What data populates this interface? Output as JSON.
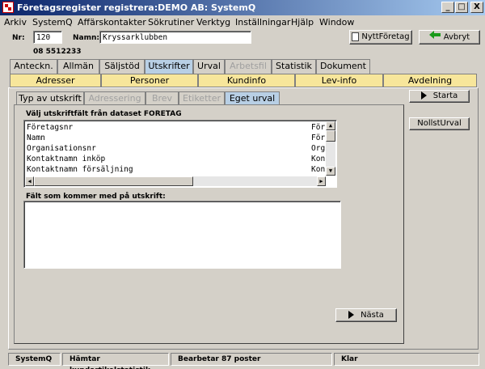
{
  "window": {
    "title": "Företagsregister registrera:DEMO AB: SystemQ",
    "minimize": "_",
    "maximize": "□",
    "close": "X"
  },
  "menu": [
    "Arkiv",
    "SystemQ",
    "Affärskontakter",
    "Sökrutiner",
    "Verktyg",
    "Inställningar",
    "Hjälp",
    "Window"
  ],
  "header": {
    "nr_label": "Nr:",
    "nr_value": "120",
    "namn_label": "Namn:",
    "namn_value": "Kryssarklubben",
    "phone": "08 5512233",
    "new_company_button": "NyttFöretag",
    "cancel_button": "Avbryt"
  },
  "tabs_row1": [
    "Anteckn.",
    "Allmän",
    "Säljstöd",
    "Utskrifter",
    "Urval",
    "Arbetsfil",
    "Statistik",
    "Dokument"
  ],
  "tabs_row2": [
    "Adresser",
    "Personer",
    "Kundinfo",
    "Lev-info",
    "Avdelning"
  ],
  "subtabs": [
    "Typ av utskrift",
    "Adressering",
    "Brev",
    "Etiketter",
    "Eget urval"
  ],
  "fields_panel": {
    "title": "Välj utskriftfält från dataset FORETAG",
    "rows": [
      {
        "name": "Företagsnr",
        "code": "Före"
      },
      {
        "name": "Namn",
        "code": "Före"
      },
      {
        "name": "Organisationsnr",
        "code": "Org"
      },
      {
        "name": "Kontaktnamn inköp",
        "code": "Kont"
      },
      {
        "name": "Kontaktnamn försäljning",
        "code": "Kont"
      }
    ],
    "selected_title": "Fält som kommer med på utskrift:"
  },
  "buttons": {
    "next": "Nästa",
    "start": "Starta",
    "reset": "NollstUrval"
  },
  "status": [
    "SystemQ",
    "Hämtar kundartikelstatistik",
    "Bearbetar 87 poster",
    "Klar"
  ],
  "colors": {
    "titlebar_start": "#0a246a",
    "active_tab": "#b8cfe5",
    "second_row_tabs": "#f7e69b",
    "cancel_arrow": "#1a9a1a"
  }
}
